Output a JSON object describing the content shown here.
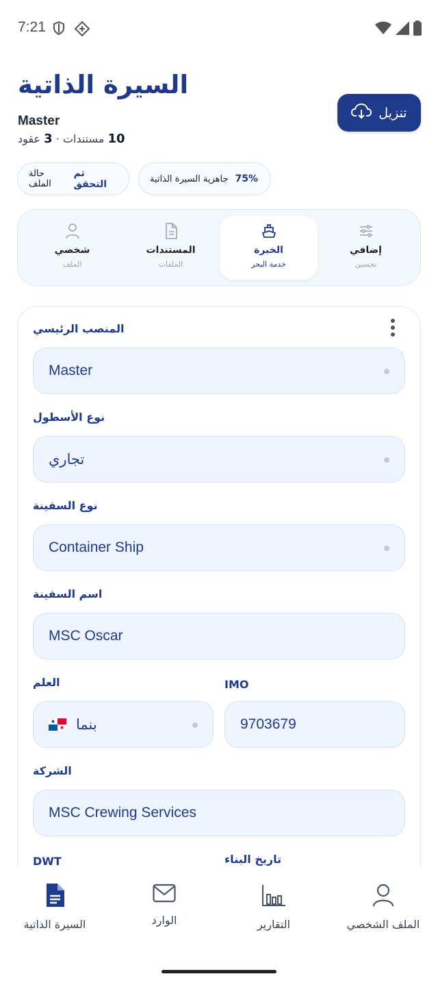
{
  "status_bar": {
    "time": "7:21",
    "icons": [
      "shield-icon",
      "diamond-grid-icon",
      "wifi-icon",
      "signal-icon",
      "battery-icon"
    ]
  },
  "header": {
    "title": "السيرة الذاتية",
    "rank": "Master",
    "counts": {
      "documents_num": "10",
      "documents_label": "مستندات",
      "separator": "·",
      "contracts_num": "3",
      "contracts_label": "عقود"
    },
    "download_label": "تنزيل"
  },
  "chips": {
    "file_status_label": "حالة الملف",
    "file_status_value": "تم التحقق",
    "readiness_label": "جاهزية السيرة الذاتية",
    "readiness_value": "75%"
  },
  "tabs": [
    {
      "label": "شخصي",
      "sub": "الملف",
      "icon": "person-icon"
    },
    {
      "label": "المستندات",
      "sub": "الملفات",
      "icon": "document-icon"
    },
    {
      "label": "الخبرة",
      "sub": "خدمة البحر",
      "icon": "ship-icon",
      "active": true
    },
    {
      "label": "إضافي",
      "sub": "تحسين",
      "icon": "sliders-icon"
    }
  ],
  "form": {
    "main_position": {
      "label": "المنصب الرئيسي",
      "value": "Master"
    },
    "fleet_type": {
      "label": "نوع الأسطول",
      "value": "تجاري"
    },
    "vessel_type": {
      "label": "نوع السفينة",
      "value": "Container Ship"
    },
    "vessel_name": {
      "label": "اسم السفينة",
      "value": "MSC Oscar"
    },
    "imo": {
      "label": "IMO",
      "value": "9703679"
    },
    "flag": {
      "label": "العلم",
      "value": "بنما"
    },
    "company": {
      "label": "الشركة",
      "value": "MSC Crewing Services"
    },
    "dwt": {
      "label": "DWT"
    },
    "build_date": {
      "label": "تاريخ البناء"
    }
  },
  "bottom_nav": [
    {
      "label": "السيرة الذاتية",
      "icon": "cv-document-icon",
      "active": true
    },
    {
      "label": "الوارد",
      "icon": "mail-icon"
    },
    {
      "label": "التقارير",
      "icon": "bar-chart-icon"
    },
    {
      "label": "الملف الشخصي",
      "icon": "profile-icon"
    }
  ],
  "colors": {
    "primary": "#1f3a8a",
    "field_bg": "#eef5ff",
    "border": "#d5e3f5"
  }
}
